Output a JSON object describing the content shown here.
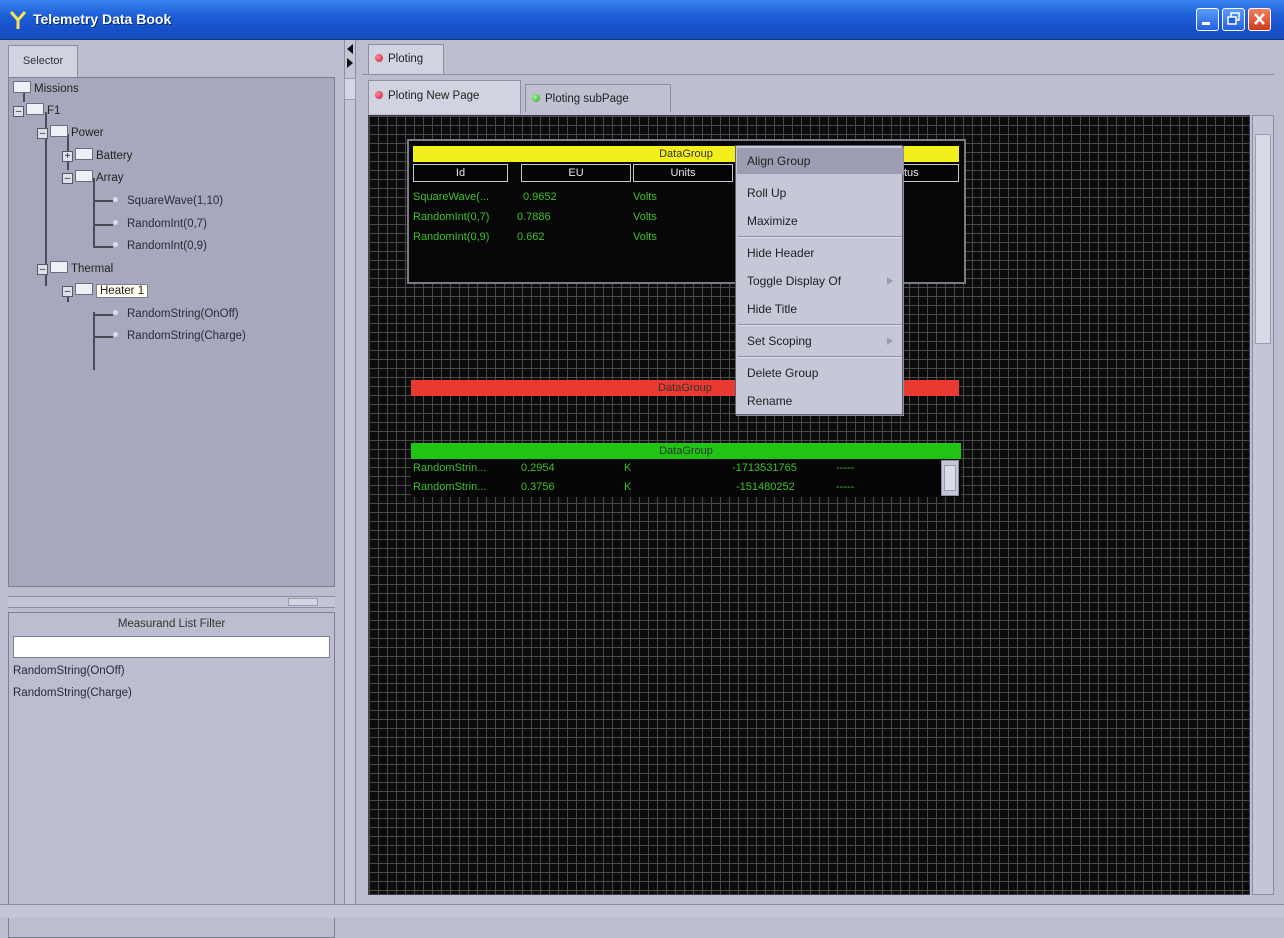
{
  "window": {
    "title": "Telemetry Data Book"
  },
  "left": {
    "selector_tab": "Selector",
    "tree": {
      "missions": "Missions",
      "f1": "F1",
      "power": "Power",
      "battery": "Battery",
      "array": "Array",
      "array_leaves": [
        "SquareWave(1,10)",
        "RandomInt(0,7)",
        "RandomInt(0,9)"
      ],
      "thermal": "Thermal",
      "heater": "Heater 1",
      "heater_leaves": [
        "RandomString(OnOff)",
        "RandomString(Charge)"
      ]
    },
    "filter": {
      "title": "Measurand List Filter",
      "value": "",
      "items": [
        "RandomString(OnOff)",
        "RandomString(Charge)"
      ]
    }
  },
  "right": {
    "outer_tab": "Ploting",
    "tabs": [
      "Ploting New Page",
      "Ploting subPage"
    ]
  },
  "groups": {
    "yellow": {
      "title": "DataGroup",
      "color": "#f2ef1d",
      "headers": [
        "Id",
        "EU",
        "Units",
        "tus"
      ],
      "rows": [
        {
          "id": "SquareWave(...",
          "eu": "0.9652",
          "units": "Volts"
        },
        {
          "id": "RandomInt(0,7)",
          "eu": "0.7886",
          "units": "Volts"
        },
        {
          "id": "RandomInt(0,9)",
          "eu": "0.662",
          "units": "Volts"
        }
      ]
    },
    "red": {
      "title": "DataGroup",
      "color": "#e83a30"
    },
    "green": {
      "title": "DataGroup",
      "color": "#1fc414",
      "rows": [
        {
          "id": "RandomStrin...",
          "eu": "0.2954",
          "units": "K",
          "raw": "-1713531765",
          "status": "-----"
        },
        {
          "id": "RandomStrin...",
          "eu": "0.3756",
          "units": "K",
          "raw": "-151480252",
          "status": "-----"
        }
      ]
    }
  },
  "context_menu": {
    "items": [
      {
        "label": "Align Group",
        "submenu": false
      },
      {
        "label": "Roll Up",
        "submenu": false
      },
      {
        "label": "Maximize",
        "submenu": false
      },
      {
        "label": "Hide Header",
        "submenu": false
      },
      {
        "label": "Toggle Display Of",
        "submenu": true
      },
      {
        "label": "Hide Title",
        "submenu": false
      },
      {
        "label": "Set Scoping",
        "submenu": true
      },
      {
        "label": "Delete Group",
        "submenu": false
      },
      {
        "label": "Rename",
        "submenu": false
      }
    ]
  }
}
